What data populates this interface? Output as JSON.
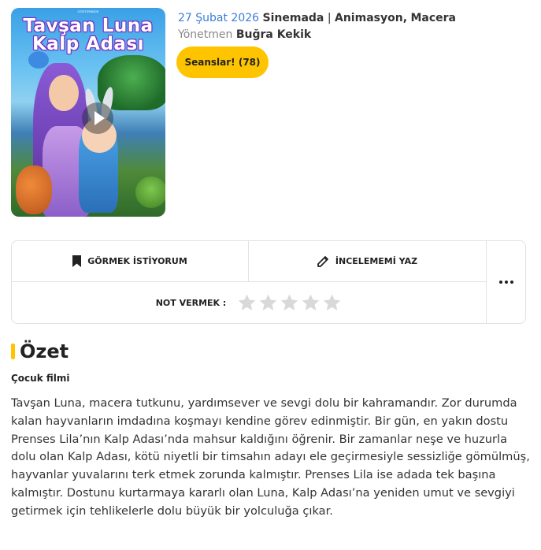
{
  "poster": {
    "title_line1": "Tavşan Luna",
    "title_line2": "Kalp Adası",
    "credits": "GÖSTERİMDE",
    "play_icon": "play-icon"
  },
  "meta": {
    "date": "27 Şubat 2026",
    "release_status": "Sinemada",
    "separator": "|",
    "genres": [
      "Animasyon",
      "Macera"
    ],
    "director_label": "Yönetmen",
    "director_name": "Buğra Kekik"
  },
  "showtimes_button": "Seanslar! (78)",
  "actions": {
    "watchlist_label": "GÖRMEK İSTİYORUM",
    "watchlist_icon": "bookmark-icon",
    "review_label": "İNCELEMEMİ YAZ",
    "review_icon": "pencil-icon",
    "rate_label": "NOT VERMEK :",
    "rating_max": 5,
    "rating_value": 0,
    "more_icon": "more-dots-icon"
  },
  "summary": {
    "title": "Özet",
    "genre_tag": "Çocuk filmi",
    "text": "Tavşan Luna, macera tutkunu, yardımsever ve sevgi dolu bir kahramandır. Zor durumda kalan hayvanların imdadına koşmayı kendine görev edinmiştir. Bir gün, en yakın dostu Prenses Lila’nın Kalp Adası’nda mahsur kaldığını öğrenir. Bir zamanlar neşe ve huzurla dolu olan Kalp Adası, kötü niyetli bir timsahın adayı ele geçirmesiyle sessizliğe gömülmüş, hayvanlar yuvalarını terk etmek zorunda kalmıştır. Prenses Lila ise adada tek başına kalmıştır. Dostunu kurtarmaya kararlı olan Luna, Kalp Adası’na yeniden umut ve sevgiyi getirmek için tehlikelerle dolu büyük bir yolculuğa çıkar."
  },
  "colors": {
    "accent": "#ffc400",
    "date": "#3b7dd8",
    "star_empty": "#d9d9d9"
  }
}
